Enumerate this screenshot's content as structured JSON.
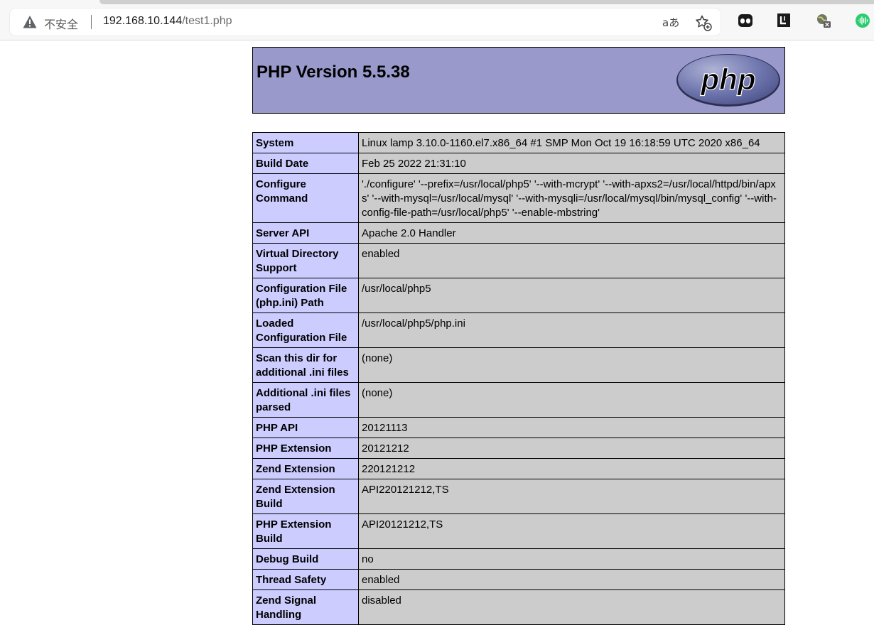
{
  "browser": {
    "insecure_label": "不安全",
    "url_host": "192.168.10.144",
    "url_path": "/test1.php",
    "read_aloud_label": "aあ"
  },
  "header": {
    "title": "PHP Version 5.5.38",
    "logo_text": "php"
  },
  "rows": [
    {
      "key": "System",
      "value": "Linux lamp 3.10.0-1160.el7.x86_64 #1 SMP Mon Oct 19 16:18:59 UTC 2020 x86_64"
    },
    {
      "key": "Build Date",
      "value": "Feb 25 2022 21:31:10"
    },
    {
      "key": "Configure Command",
      "value": "'./configure' '--prefix=/usr/local/php5' '--with-mcrypt' '--with-apxs2=/usr/local/httpd/bin/apxs' '--with-mysql=/usr/local/mysql' '--with-mysqli=/usr/local/mysql/bin/mysql_config' '--with-config-file-path=/usr/local/php5' '--enable-mbstring'"
    },
    {
      "key": "Server API",
      "value": "Apache 2.0 Handler"
    },
    {
      "key": "Virtual Directory Support",
      "value": "enabled"
    },
    {
      "key": "Configuration File (php.ini) Path",
      "value": "/usr/local/php5"
    },
    {
      "key": "Loaded Configuration File",
      "value": "/usr/local/php5/php.ini"
    },
    {
      "key": "Scan this dir for additional .ini files",
      "value": "(none)"
    },
    {
      "key": "Additional .ini files parsed",
      "value": "(none)"
    },
    {
      "key": "PHP API",
      "value": "20121113"
    },
    {
      "key": "PHP Extension",
      "value": "20121212"
    },
    {
      "key": "Zend Extension",
      "value": "220121212"
    },
    {
      "key": "Zend Extension Build",
      "value": "API220121212,TS"
    },
    {
      "key": "PHP Extension Build",
      "value": "API20121212,TS"
    },
    {
      "key": "Debug Build",
      "value": "no"
    },
    {
      "key": "Thread Safety",
      "value": "enabled"
    },
    {
      "key": "Zend Signal Handling",
      "value": "disabled"
    }
  ],
  "colors": {
    "header_bg": "#9999cc",
    "key_bg": "#ccccff",
    "value_bg": "#cccccc"
  }
}
